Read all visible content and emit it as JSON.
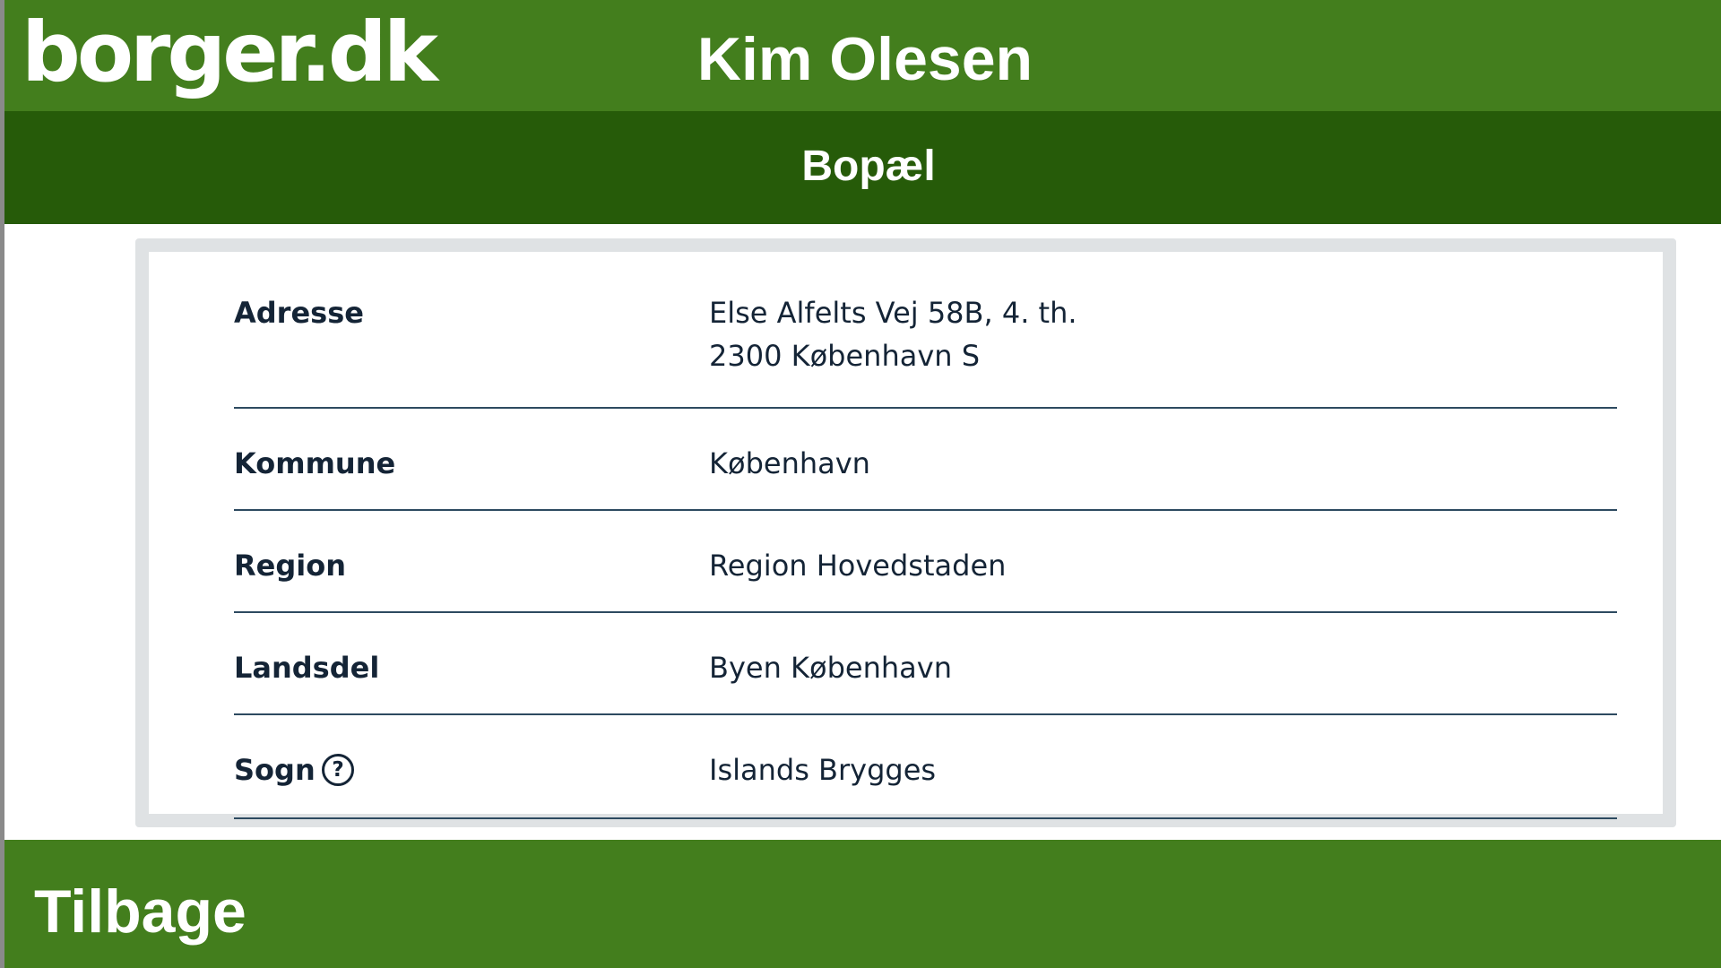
{
  "header": {
    "logo_text": "borger.dk",
    "user_name": "Kim Olesen"
  },
  "section": {
    "title": "Bopæl"
  },
  "details": {
    "address": {
      "label": "Adresse",
      "line1": "Else Alfelts Vej 58B, 4. th.",
      "line2": "2300 København S"
    },
    "municipality": {
      "label": "Kommune",
      "value": "København"
    },
    "region": {
      "label": "Region",
      "value": "Region Hovedstaden"
    },
    "district": {
      "label": "Landsdel",
      "value": "Byen København"
    },
    "parish": {
      "label": "Sogn",
      "help_icon": "?",
      "value": "Islands Brygges"
    }
  },
  "footer": {
    "back_label": "Tilbage"
  },
  "colors": {
    "header_green": "#437e1d",
    "section_dark_green": "#265b09",
    "card_border": "#dfe2e4",
    "text_navy": "#142436",
    "divider": "#2d4a60"
  }
}
